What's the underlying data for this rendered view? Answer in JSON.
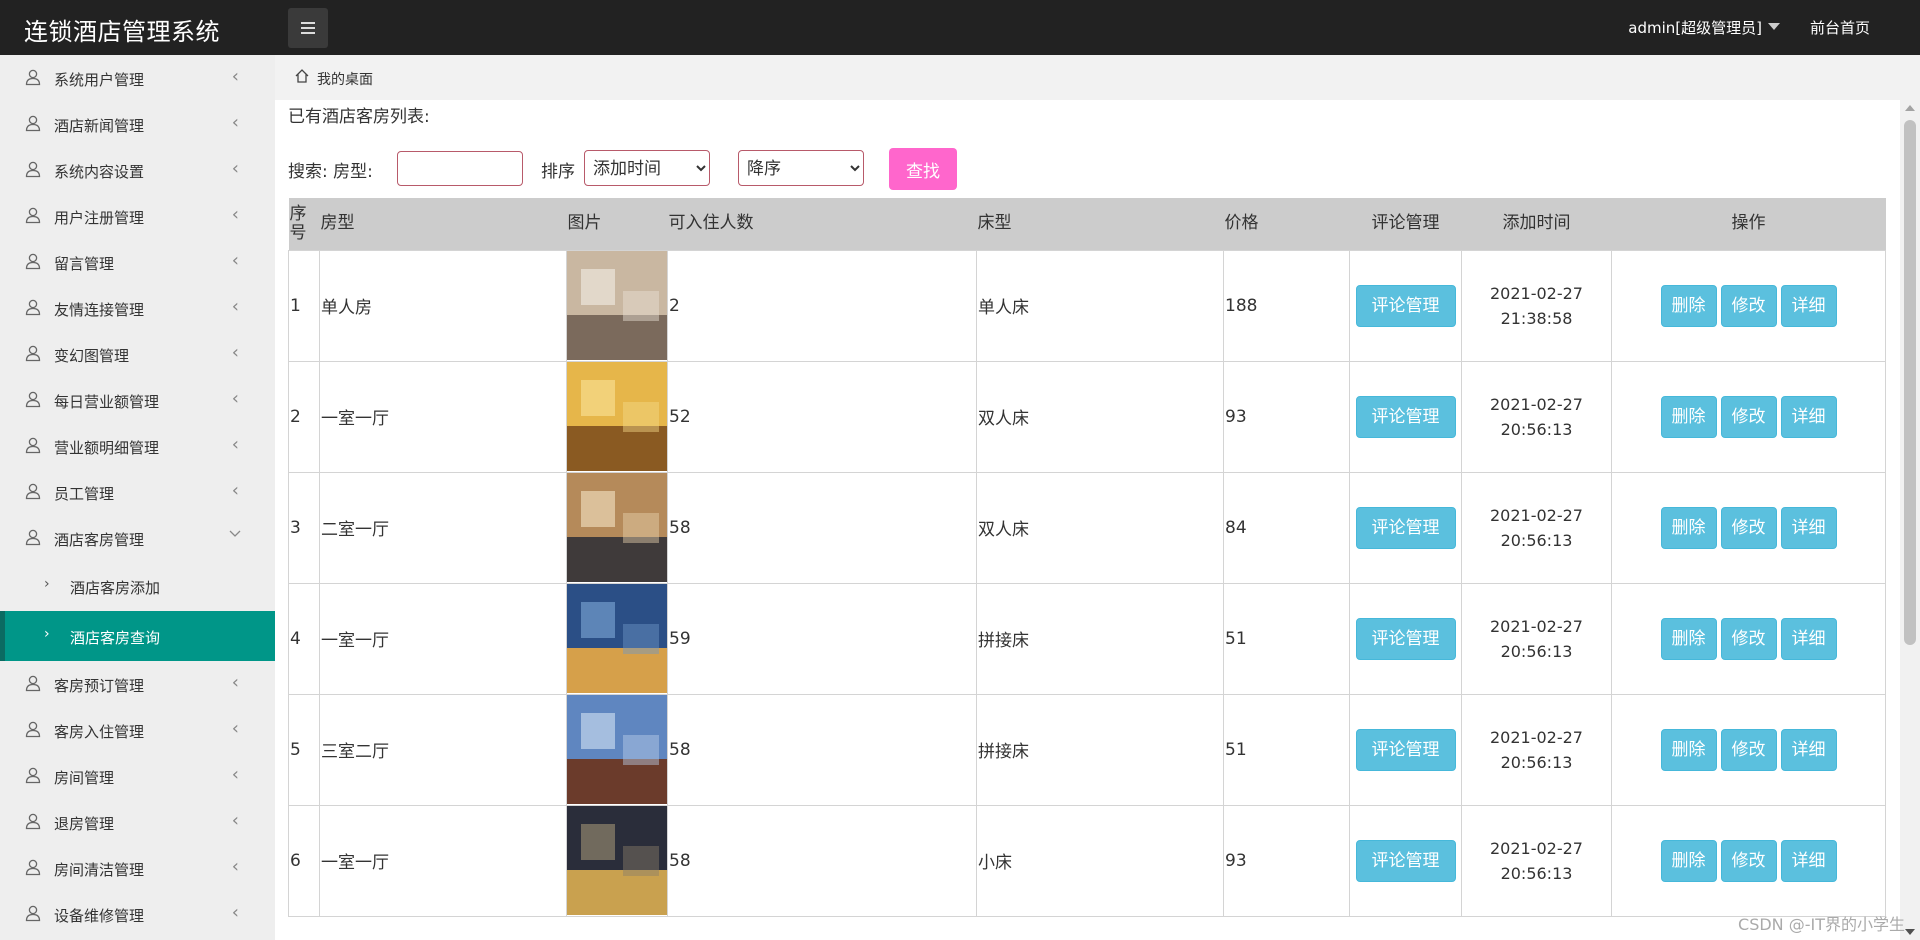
{
  "header": {
    "brand": "连锁酒店管理系统",
    "user": "admin[超级管理员]",
    "home_link": "前台首页"
  },
  "sidebar": {
    "items": [
      {
        "label": "系统用户管理"
      },
      {
        "label": "酒店新闻管理"
      },
      {
        "label": "系统内容设置"
      },
      {
        "label": "用户注册管理"
      },
      {
        "label": "留言管理"
      },
      {
        "label": "友情连接管理"
      },
      {
        "label": "变幻图管理"
      },
      {
        "label": "每日营业额管理"
      },
      {
        "label": "营业额明细管理"
      },
      {
        "label": "员工管理"
      },
      {
        "label": "酒店客房管理"
      }
    ],
    "sub_items": [
      {
        "label": "酒店客房添加"
      },
      {
        "label": "酒店客房查询"
      }
    ],
    "items_after": [
      {
        "label": "客房预订管理"
      },
      {
        "label": "客房入住管理"
      },
      {
        "label": "房间管理"
      },
      {
        "label": "退房管理"
      },
      {
        "label": "房间清洁管理"
      },
      {
        "label": "设备维修管理"
      }
    ]
  },
  "breadcrumb": {
    "current": "我的桌面"
  },
  "main": {
    "list_title": "已有酒店客房列表:",
    "search": {
      "label": "搜索: 房型:",
      "input_value": "",
      "sort_label": "排序",
      "sort_field": "添加时间",
      "sort_order": "降序",
      "button": "查找"
    },
    "table": {
      "headers": {
        "index": "序号",
        "type": "房型",
        "image": "图片",
        "capacity": "可入住人数",
        "bed": "床型",
        "price": "价格",
        "comments": "评论管理",
        "added": "添加时间",
        "actions": "操作"
      },
      "row_buttons": {
        "comments": "评论管理",
        "delete": "删除",
        "edit": "修改",
        "detail": "详细"
      },
      "rows": [
        {
          "index": "1",
          "type": "单人房",
          "capacity": "2",
          "bed": "单人床",
          "price": "188",
          "date": "2021-02-27",
          "time": "21:38:58"
        },
        {
          "index": "2",
          "type": "一室一厅",
          "capacity": "52",
          "bed": "双人床",
          "price": "93",
          "date": "2021-02-27",
          "time": "20:56:13"
        },
        {
          "index": "3",
          "type": "二室一厅",
          "capacity": "58",
          "bed": "双人床",
          "price": "84",
          "date": "2021-02-27",
          "time": "20:56:13"
        },
        {
          "index": "4",
          "type": "一室一厅",
          "capacity": "59",
          "bed": "拼接床",
          "price": "51",
          "date": "2021-02-27",
          "time": "20:56:13"
        },
        {
          "index": "5",
          "type": "三室二厅",
          "capacity": "58",
          "bed": "拼接床",
          "price": "51",
          "date": "2021-02-27",
          "time": "20:56:13"
        },
        {
          "index": "6",
          "type": "一室一厅",
          "capacity": "58",
          "bed": "小床",
          "price": "93",
          "date": "2021-02-27",
          "time": "20:56:13"
        }
      ]
    }
  },
  "watermark": "CSDN @-IT界的小学生",
  "colors": {
    "header_bg": "#222222",
    "active_menu": "#009688",
    "find_button": "#ff66cc",
    "info_button": "#5bc0de",
    "table_header": "#cccccc"
  }
}
